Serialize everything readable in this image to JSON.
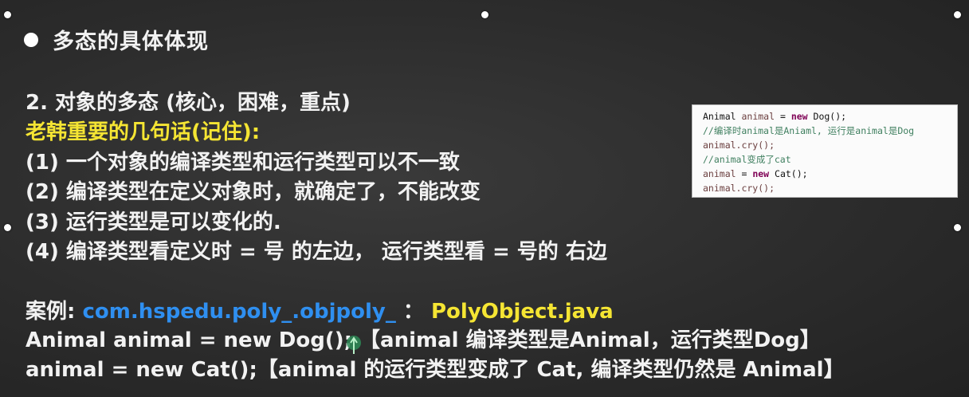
{
  "slide": {
    "title": "多态的具体体现",
    "heading": "2. 对象的多态 (核心，困难，重点)",
    "key_note": "老韩重要的几句话(记住):",
    "points": [
      "(1) 一个对象的编译类型和运行类型可以不一致",
      "(2) 编译类型在定义对象时，就确定了，不能改变",
      "(3) 运行类型是可以变化的.",
      "(4) 编译类型看定义时 = 号 的左边， 运行类型看 = 号的 右边"
    ],
    "case_label": "案例:",
    "case_package": "com.hspedu.poly_.objpoly_",
    "case_sep": " ：",
    "case_file": "PolyObject.java",
    "example1": "Animal animal = new Dog(); 【animal 编译类型是Animal，运行类型Dog】",
    "example2": "animal = new Cat();【animal 的运行类型变成了 Cat, 编译类型仍然是 Animal】"
  },
  "code": {
    "l1_type": "Animal",
    "l1_var": "animal",
    "l1_eq": " = ",
    "l1_new": "new",
    "l1_rest": " Dog();",
    "l2_comment": "//编译时animal是Aniaml, 运行是animal是Dog",
    "l3": "animal.cry();",
    "l4_comment": "//animal变成了cat",
    "l5_var": "animal",
    "l5_eq": " = ",
    "l5_new": "new",
    "l5_rest": " Cat();",
    "l6": "animal.cry();"
  },
  "colors": {
    "accent_yellow": "#f5e533",
    "accent_blue": "#2f8ff0"
  }
}
